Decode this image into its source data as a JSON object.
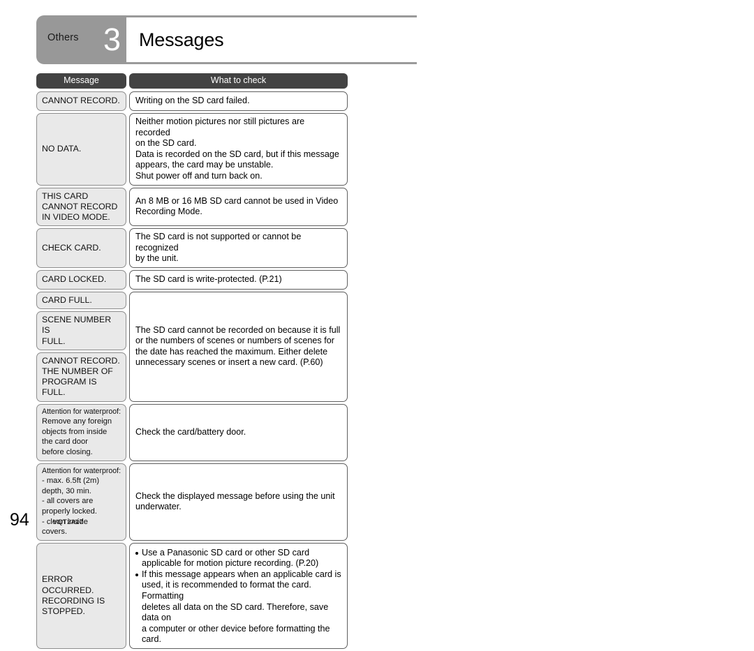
{
  "header": {
    "chapter_tab_label": "Others",
    "chapter_number": "3",
    "title": "Messages"
  },
  "table": {
    "columns": {
      "message": "Message",
      "what_to_check": "What to check"
    },
    "rows": [
      {
        "messages": [
          "CANNOT RECORD."
        ],
        "check": "Writing on the SD card failed."
      },
      {
        "messages": [
          "NO DATA."
        ],
        "check": "Neither motion pictures nor still pictures are recorded\non the SD card.\nData is recorded on the SD card, but if this message\nappears, the card may be unstable.\nShut power off and turn back on."
      },
      {
        "messages": [
          "THIS CARD\nCANNOT RECORD\nIN VIDEO MODE."
        ],
        "check": "An 8 MB or 16 MB SD card cannot be used in Video\nRecording Mode."
      },
      {
        "messages": [
          "CHECK CARD."
        ],
        "check": "The SD card is not supported or cannot be recognized\nby the unit."
      },
      {
        "messages": [
          "CARD LOCKED."
        ],
        "check": "The SD card is write-protected. (P.21)"
      },
      {
        "messages": [
          "CARD FULL.",
          "SCENE NUMBER IS\nFULL.",
          "CANNOT RECORD.\nTHE NUMBER OF\nPROGRAM IS FULL."
        ],
        "check": "The SD card cannot be recorded on because it is full\nor the numbers of scenes or numbers of scenes for\nthe date has reached the maximum. Either delete\nunnecessary scenes or insert a new card. (P.60)"
      },
      {
        "messages_lead": "Attention for waterproof:",
        "messages": [
          "Remove any foreign\nobjects from inside\nthe card door\nbefore closing."
        ],
        "check": "Check the card/battery door."
      },
      {
        "messages_lead": "Attention for waterproof:",
        "messages": [
          "- max. 6.5ft (2m)\n  depth, 30 min.\n- all covers are\n  properly locked.\n- clean inside\n  covers."
        ],
        "check": "Check the displayed message before using the unit\nunderwater."
      },
      {
        "messages": [
          "ERROR\nOCCURRED.\nRECORDING IS\nSTOPPED."
        ],
        "check_bullets": [
          "Use a Panasonic SD card or other SD card\napplicable for motion picture recording. (P.20)",
          "If this message appears when an applicable card is\nused, it is recommended to format the card. Formatting\ndeletes all data on the SD card. Therefore, save data on\na computer or other device before formatting the card."
        ]
      }
    ]
  },
  "footer": {
    "page_number": "94",
    "doc_code": "VQT2A17"
  }
}
